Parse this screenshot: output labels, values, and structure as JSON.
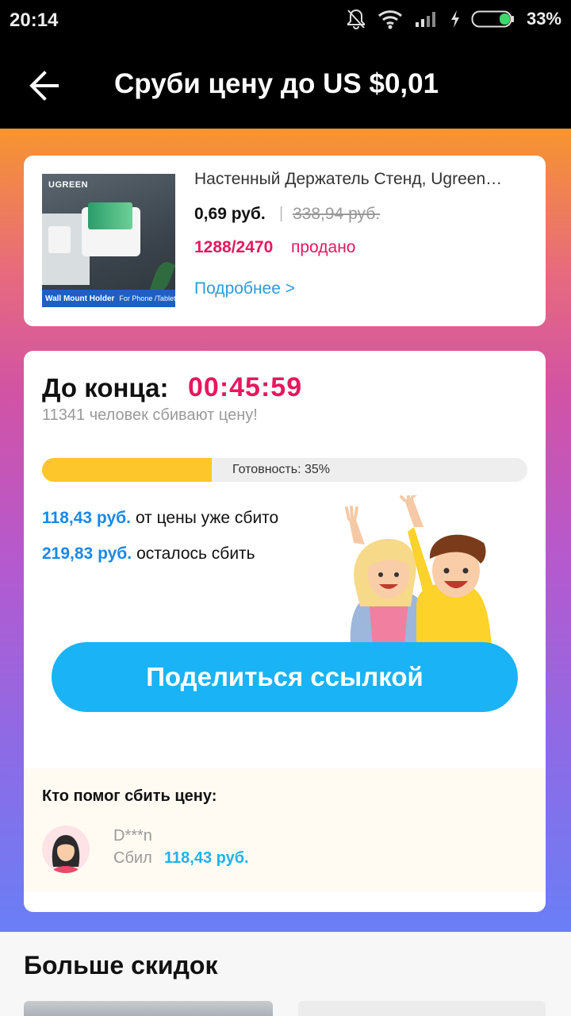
{
  "status_bar": {
    "time": "20:14",
    "battery": "33%"
  },
  "toolbar": {
    "title": "Сруби цену до US $0,01"
  },
  "product": {
    "thumb_brand": "UGREEN",
    "thumb_caption": "Wall Mount Holder",
    "thumb_caption_sub": "For Phone /Tablet",
    "name": "Настенный Держатель Стенд, Ugreen…",
    "price": "0,69 руб.",
    "separator": "|",
    "old_price": "338,94 руб.",
    "sold_count": "1288/2470",
    "sold_label": "продано",
    "more_link": "Подробнее >"
  },
  "countdown": {
    "label": "До конца:",
    "timer": "00:45:59",
    "people": "11341 человек сбивают цену!",
    "progress_label": "Готовность: 35%",
    "progress_value": 0.35
  },
  "stats": [
    {
      "amount": "118,43 руб.",
      "text": "от цены уже сбито"
    },
    {
      "amount": "219,83 руб.",
      "text": "осталось сбить"
    }
  ],
  "share_button": "Поделиться ссылкой",
  "helpers": {
    "title": "Кто помог сбить цену:",
    "items": [
      {
        "name": "D***n",
        "did_label": "Сбил",
        "amount": "118,43 руб."
      }
    ]
  },
  "more_discounts": {
    "title": "Больше скидок"
  },
  "colors": {
    "accent_pink": "#e8175d",
    "accent_blue": "#1ab3f5",
    "progress": "#fdc62b"
  }
}
